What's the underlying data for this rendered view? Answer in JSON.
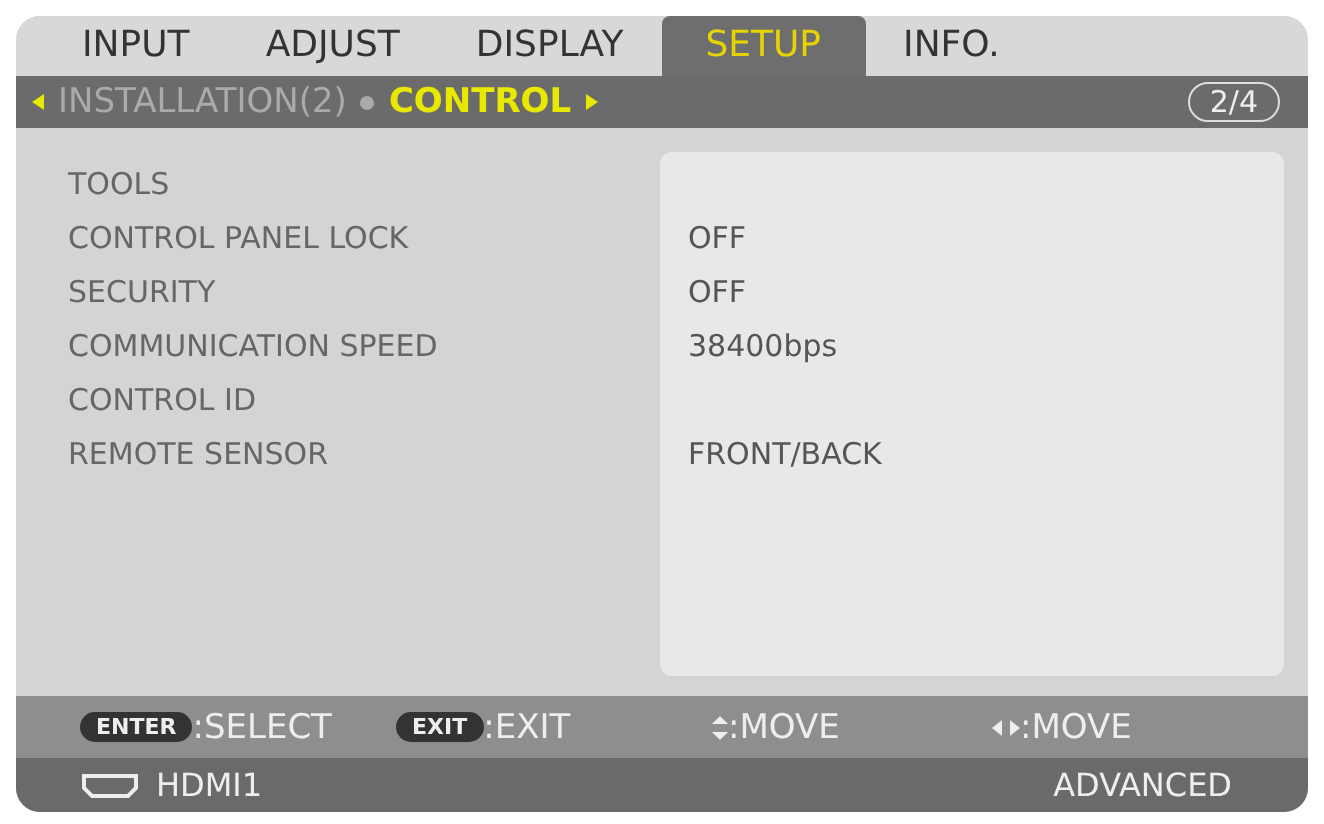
{
  "tabs": [
    {
      "label": "INPUT",
      "selected": false
    },
    {
      "label": "ADJUST",
      "selected": false
    },
    {
      "label": "DISPLAY",
      "selected": false
    },
    {
      "label": "SETUP",
      "selected": true
    },
    {
      "label": "INFO.",
      "selected": false
    }
  ],
  "breadcrumb": {
    "previous": "INSTALLATION(2)",
    "current": "CONTROL",
    "page": "2/4"
  },
  "rows": [
    {
      "label": "TOOLS"
    },
    {
      "label": "CONTROL PANEL LOCK",
      "value": "OFF"
    },
    {
      "label": "SECURITY",
      "value": "OFF"
    },
    {
      "label": "COMMUNICATION SPEED",
      "value": "38400bps"
    },
    {
      "label": "CONTROL ID"
    },
    {
      "label": "REMOTE SENSOR",
      "value": "FRONT/BACK"
    }
  ],
  "hints": [
    {
      "kind": "key",
      "key": "ENTER",
      "text": ":SELECT"
    },
    {
      "kind": "key",
      "key": "EXIT",
      "text": ":EXIT"
    },
    {
      "kind": "updown",
      "text": ":MOVE"
    },
    {
      "kind": "leftright",
      "text": ":MOVE"
    }
  ],
  "status": {
    "source": "HDMI1",
    "mode": "ADVANCED"
  }
}
